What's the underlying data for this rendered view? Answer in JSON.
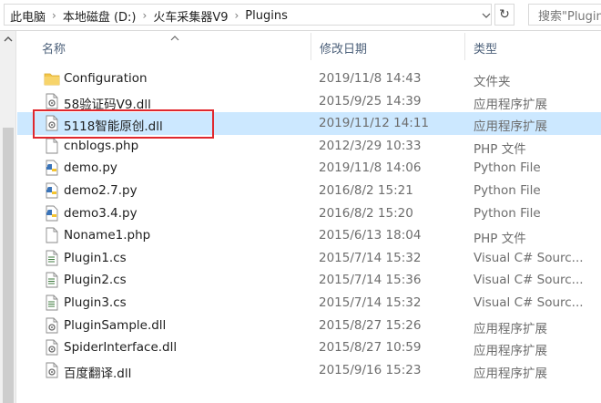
{
  "address": {
    "crumbs": [
      "此电脑",
      "本地磁盘 (D:)",
      "火车采集器V9",
      "Plugins"
    ],
    "search_placeholder": "搜索\"Plugins\""
  },
  "columns": {
    "name": "名称",
    "date": "修改日期",
    "type": "类型"
  },
  "files": [
    {
      "icon": "folder-icon",
      "name": "Configuration",
      "date": "2019/11/8 14:43",
      "type": "文件夹"
    },
    {
      "icon": "dll-file-icon",
      "name": "58验证码V9.dll",
      "date": "2015/9/25 14:39",
      "type": "应用程序扩展"
    },
    {
      "icon": "dll-file-icon",
      "name": "5118智能原创.dll",
      "date": "2019/11/12 14:11",
      "type": "应用程序扩展"
    },
    {
      "icon": "file-icon",
      "name": "cnblogs.php",
      "date": "2012/3/29 10:33",
      "type": "PHP 文件"
    },
    {
      "icon": "python-file-icon",
      "name": "demo.py",
      "date": "2019/11/8 14:06",
      "type": "Python File"
    },
    {
      "icon": "python-file-icon",
      "name": "demo2.7.py",
      "date": "2016/8/2 15:21",
      "type": "Python File"
    },
    {
      "icon": "python-file-icon",
      "name": "demo3.4.py",
      "date": "2016/8/2 15:20",
      "type": "Python File"
    },
    {
      "icon": "file-icon",
      "name": "Noname1.php",
      "date": "2015/6/13 18:04",
      "type": "PHP 文件"
    },
    {
      "icon": "cs-file-icon",
      "name": "Plugin1.cs",
      "date": "2015/7/14 15:32",
      "type": "Visual C# Sourc..."
    },
    {
      "icon": "cs-file-icon",
      "name": "Plugin2.cs",
      "date": "2015/7/14 15:36",
      "type": "Visual C# Sourc..."
    },
    {
      "icon": "cs-file-icon",
      "name": "Plugin3.cs",
      "date": "2015/7/14 15:32",
      "type": "Visual C# Sourc..."
    },
    {
      "icon": "dll-file-icon",
      "name": "PluginSample.dll",
      "date": "2015/8/27 15:26",
      "type": "应用程序扩展"
    },
    {
      "icon": "dll-file-icon",
      "name": "SpiderInterface.dll",
      "date": "2015/8/27 10:59",
      "type": "应用程序扩展"
    },
    {
      "icon": "dll-file-icon",
      "name": "百度翻译.dll",
      "date": "2015/9/16 15:23",
      "type": "应用程序扩展"
    }
  ],
  "selected_index": 2,
  "colors": {
    "selection": "#cce8ff",
    "highlight_border": "#e0282e",
    "folder": "#f3c64a"
  }
}
